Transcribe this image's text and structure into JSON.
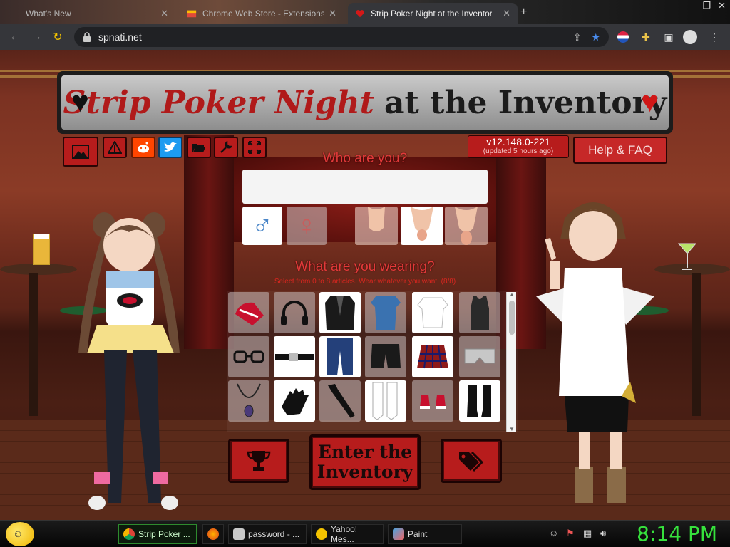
{
  "browser": {
    "tabs": [
      {
        "title": "What's New",
        "active": false
      },
      {
        "title": "Chrome Web Store - Extensions",
        "active": false
      },
      {
        "title": "Strip Poker Night at the Inventor",
        "active": true
      }
    ],
    "url": "spnati.net"
  },
  "game": {
    "title_red": "Strip Poker Night",
    "title_black": "at the Inventory",
    "version": "v12.148.0-221",
    "updated": "(updated 5 hours ago)",
    "help_label": "Help & FAQ",
    "who_heading": "Who are you?",
    "name_value": "",
    "wear_heading": "What are you wearing?",
    "wear_subheading": "Select from 0 to 8 articles. Wear whatever you want. (8/8)",
    "enter_line1": "Enter the",
    "enter_line2": "Inventory",
    "colors": {
      "accent": "#b71c1c",
      "heading": "#e23a3a"
    }
  },
  "taskbar": {
    "items": [
      {
        "label": "Strip Poker ...",
        "icon": "chrome-icon",
        "active": true
      },
      {
        "label": "",
        "icon": "firefox-icon",
        "active": false
      },
      {
        "label": "password - ...",
        "icon": "paint-icon",
        "active": false
      },
      {
        "label": "Yahoo! Mes...",
        "icon": "yahoo-icon",
        "active": false
      },
      {
        "label": "Paint",
        "icon": "paint-icon",
        "active": false
      }
    ],
    "clock": "8:14 PM"
  }
}
